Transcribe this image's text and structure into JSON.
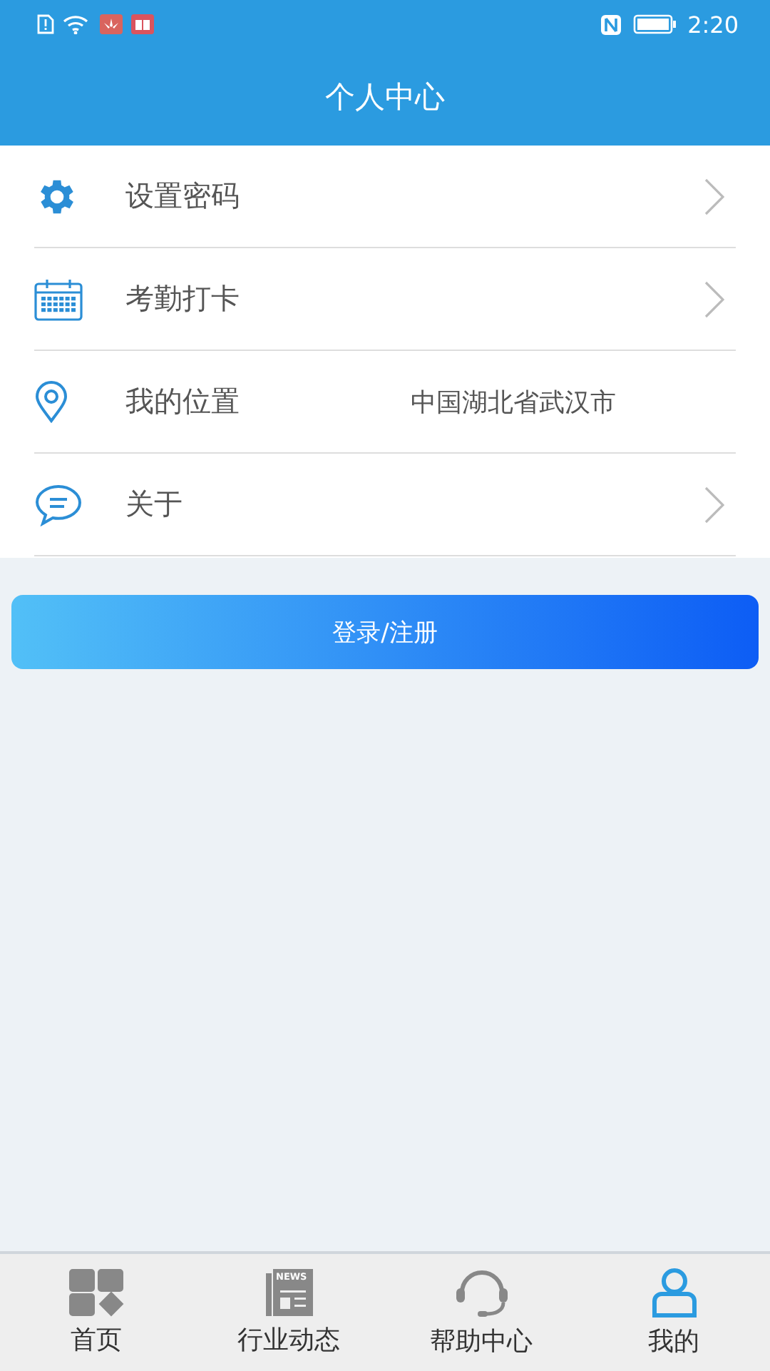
{
  "status_bar": {
    "time": "2:20"
  },
  "header": {
    "title": "个人中心"
  },
  "menu": [
    {
      "label": "设置密码",
      "kind": "link"
    },
    {
      "label": "考勤打卡",
      "kind": "link"
    },
    {
      "label": "我的位置",
      "kind": "info",
      "value": "中国湖北省武汉市"
    },
    {
      "label": "关于",
      "kind": "link"
    }
  ],
  "login_button": "登录/注册",
  "tab_bar": [
    {
      "label": "首页",
      "selected": false
    },
    {
      "label": "行业动态",
      "selected": false,
      "icon_text": "NEWS"
    },
    {
      "label": "帮助中心",
      "selected": false
    },
    {
      "label": "我的",
      "selected": true
    }
  ]
}
